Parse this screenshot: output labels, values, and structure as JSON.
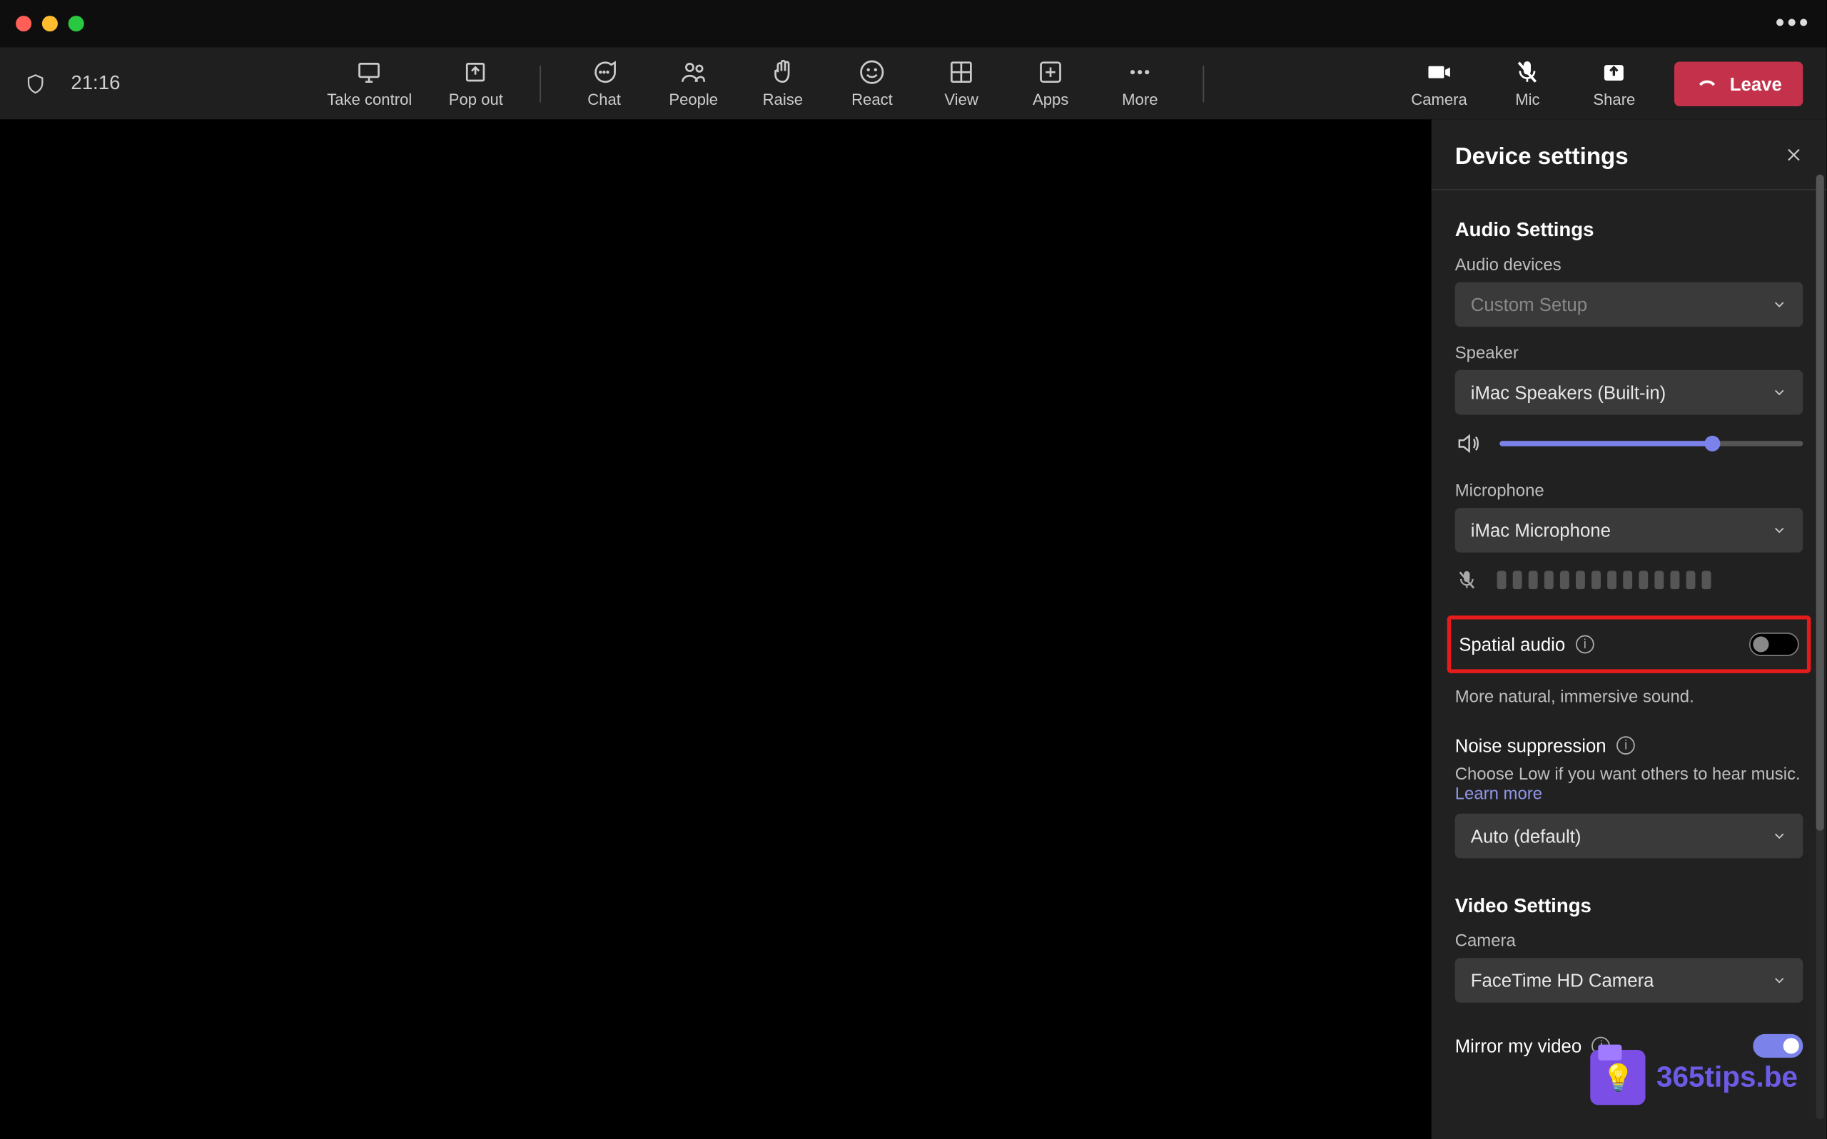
{
  "titlebar": {
    "more_icon": "more"
  },
  "toolbar": {
    "timer": "21:16",
    "take_control": "Take control",
    "pop_out": "Pop out",
    "chat": "Chat",
    "people": "People",
    "raise": "Raise",
    "react": "React",
    "view": "View",
    "apps": "Apps",
    "more": "More",
    "camera": "Camera",
    "mic": "Mic",
    "share": "Share",
    "leave": "Leave"
  },
  "panel": {
    "title": "Device settings",
    "audio_section": "Audio Settings",
    "audio_devices_label": "Audio devices",
    "audio_devices_value": "Custom Setup",
    "speaker_label": "Speaker",
    "speaker_value": "iMac Speakers (Built-in)",
    "speaker_volume_pct": 70,
    "microphone_label": "Microphone",
    "microphone_value": "iMac Microphone",
    "mic_muted": true,
    "spatial_label": "Spatial audio",
    "spatial_on": false,
    "spatial_desc": "More natural, immersive sound.",
    "noise_label": "Noise suppression",
    "noise_desc": "Choose Low if you want others to hear music. ",
    "noise_link": "Learn more",
    "noise_value": "Auto (default)",
    "video_section": "Video Settings",
    "camera_label": "Camera",
    "camera_value": "FaceTime HD Camera",
    "mirror_label": "Mirror my video",
    "mirror_on": true
  },
  "watermark": {
    "text": "365tips.be"
  }
}
